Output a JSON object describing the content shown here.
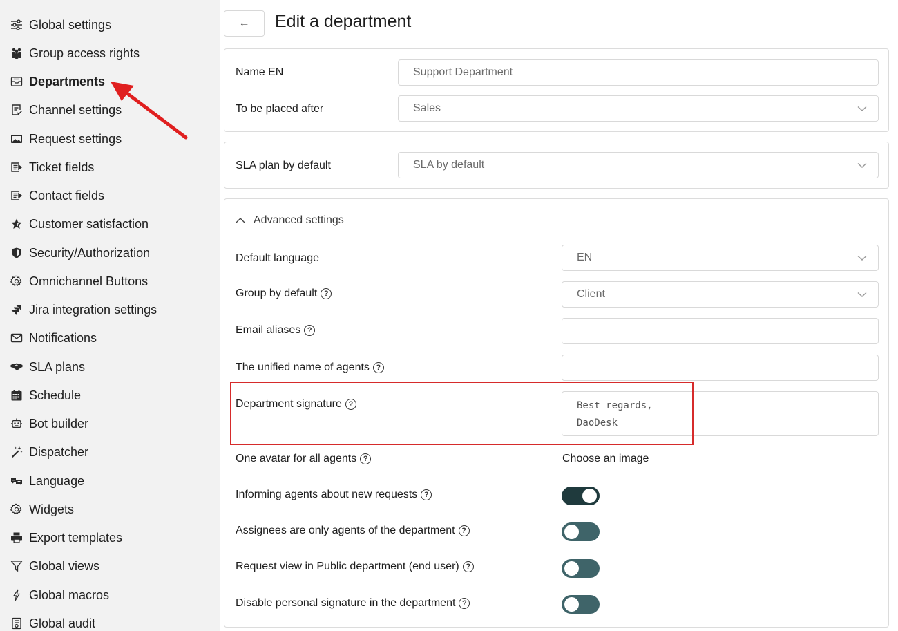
{
  "sidebar": {
    "items": [
      {
        "label": "Global settings",
        "icon": "sliders-icon"
      },
      {
        "label": "Group access rights",
        "icon": "users-group-icon"
      },
      {
        "label": "Departments",
        "icon": "inbox-tray-icon",
        "active": true
      },
      {
        "label": "Channel settings",
        "icon": "checklist-doc-icon"
      },
      {
        "label": "Request settings",
        "icon": "image-frame-icon"
      },
      {
        "label": "Ticket fields",
        "icon": "form-fields-icon"
      },
      {
        "label": "Contact fields",
        "icon": "form-fields-icon"
      },
      {
        "label": "Customer satisfaction",
        "icon": "star-icon"
      },
      {
        "label": "Security/Authorization",
        "icon": "shield-icon"
      },
      {
        "label": "Omnichannel Buttons",
        "icon": "gear-icon"
      },
      {
        "label": "Jira integration settings",
        "icon": "jira-icon"
      },
      {
        "label": "Notifications",
        "icon": "envelope-icon"
      },
      {
        "label": "SLA plans",
        "icon": "handshake-icon"
      },
      {
        "label": "Schedule",
        "icon": "calendar-icon"
      },
      {
        "label": "Bot builder",
        "icon": "robot-icon"
      },
      {
        "label": "Dispatcher",
        "icon": "magic-wand-icon"
      },
      {
        "label": "Language",
        "icon": "language-icon"
      },
      {
        "label": "Widgets",
        "icon": "gear-icon"
      },
      {
        "label": "Export templates",
        "icon": "printer-icon"
      },
      {
        "label": "Global views",
        "icon": "filter-icon"
      },
      {
        "label": "Global macros",
        "icon": "lightning-icon"
      },
      {
        "label": "Global audit",
        "icon": "audit-doc-icon"
      }
    ]
  },
  "header": {
    "back_glyph": "←",
    "title": "Edit a department"
  },
  "main_panel": {
    "name_label": "Name EN",
    "name_value": "Support Department",
    "after_label": "To be placed after",
    "after_value": "Sales"
  },
  "sla_panel": {
    "label": "SLA plan by default",
    "value": "SLA by default"
  },
  "advanced": {
    "toggle_label": "Advanced settings",
    "default_language_label": "Default language",
    "default_language_value": "EN",
    "group_label": "Group by default",
    "group_value": "Client",
    "email_aliases_label": "Email aliases",
    "email_aliases_value": "",
    "unified_name_label": "The unified name of agents",
    "unified_name_value": "",
    "signature_label": "Department signature",
    "signature_value": "Best regards,\nDaoDesk",
    "avatar_label": "One avatar for all agents",
    "avatar_link": "Choose an image",
    "informing_label": "Informing agents about new requests",
    "informing_on": true,
    "assignees_label": "Assignees are only agents of the department",
    "assignees_on": false,
    "public_view_label": "Request view in Public department (end user)",
    "public_view_on": false,
    "disable_signature_label": "Disable personal signature in the department",
    "disable_signature_on": false
  },
  "help_glyph": "?",
  "colors": {
    "sidebar_bg": "#f2f2f2",
    "toggle_on": "#1f3a3d",
    "toggle_off": "#3f6469",
    "annotation_red": "#e01f1f"
  }
}
